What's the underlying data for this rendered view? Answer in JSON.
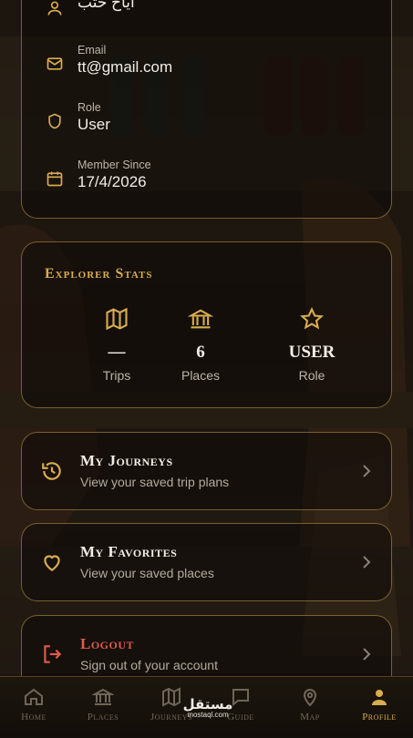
{
  "profile": {
    "name_value": "اياح حتب",
    "email_label": "Email",
    "email_value": "tt@gmail.com",
    "role_label": "Role",
    "role_value": "User",
    "member_label": "Member Since",
    "member_value": "17/4/2026"
  },
  "stats": {
    "title": "Explorer Stats",
    "items": [
      {
        "icon": "map-icon",
        "value": "—",
        "label": "Trips"
      },
      {
        "icon": "museum-icon",
        "value": "6",
        "label": "Places"
      },
      {
        "icon": "star-icon",
        "value": "USER",
        "label": "Role"
      }
    ]
  },
  "actions": {
    "journeys": {
      "title": "My Journeys",
      "subtitle": "View your saved trip plans",
      "icon": "history-icon"
    },
    "favorites": {
      "title": "My Favorites",
      "subtitle": "View your saved places",
      "icon": "heart-icon"
    },
    "logout": {
      "title": "Logout",
      "subtitle": "Sign out of your account",
      "icon": "logout-icon"
    }
  },
  "nav": {
    "items": [
      {
        "label": "Home",
        "icon": "home-icon"
      },
      {
        "label": "Places",
        "icon": "museum-icon"
      },
      {
        "label": "Journeys",
        "icon": "map-icon"
      },
      {
        "label": "Guide",
        "icon": "chat-icon"
      },
      {
        "label": "Map",
        "icon": "pin-icon"
      },
      {
        "label": "Profile",
        "icon": "person-icon"
      }
    ],
    "active_index": 5
  },
  "watermark": {
    "main": "مستقل",
    "sub": "mostaql.com"
  },
  "colors": {
    "gold": "#d8ad4f",
    "logout_red": "#e05a4c",
    "card_border": "#c9a246"
  }
}
